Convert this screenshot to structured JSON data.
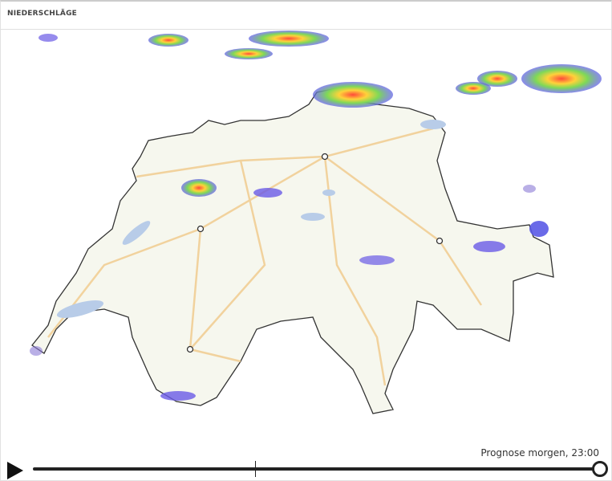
{
  "header": {
    "title": "NIEDERSCHLÄGE"
  },
  "timeline": {
    "label": "Prognose morgen, 23:00",
    "position_percent": 100
  },
  "colors": {
    "border": "#333333",
    "roads": "#f1c98a",
    "lakes": "#b8cce8",
    "rain_light": "#5a5ae6",
    "rain_mid": "#7ed957",
    "rain_heavy": "#ff5a3c"
  }
}
